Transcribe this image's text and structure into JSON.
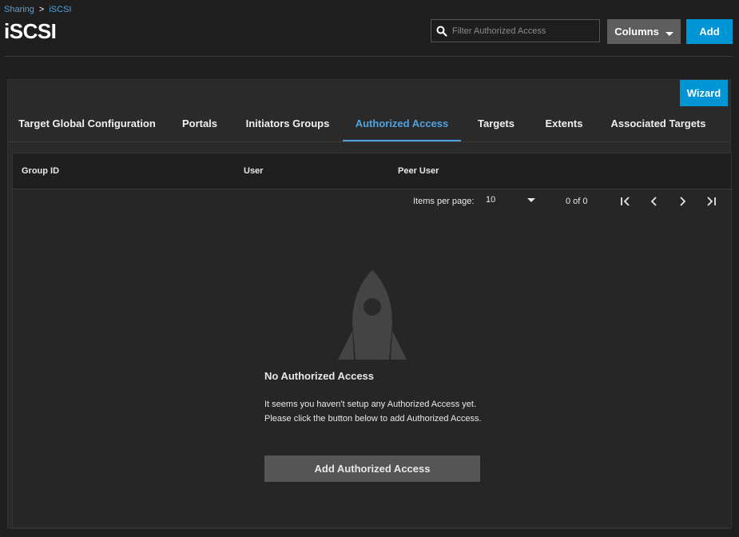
{
  "breadcrumb": {
    "parent": "Sharing",
    "separator": ">",
    "current": "iSCSI"
  },
  "page_title": "iSCSI",
  "search": {
    "placeholder": "Filter Authorized Access",
    "value": ""
  },
  "toolbar": {
    "columns_label": "Columns",
    "add_label": "Add"
  },
  "card": {
    "wizard_label": "Wizard"
  },
  "tabs": [
    {
      "label": "Target Global Configuration",
      "active": false
    },
    {
      "label": "Portals",
      "active": false
    },
    {
      "label": "Initiators Groups",
      "active": false
    },
    {
      "label": "Authorized Access",
      "active": true
    },
    {
      "label": "Targets",
      "active": false
    },
    {
      "label": "Extents",
      "active": false
    },
    {
      "label": "Associated Targets",
      "active": false
    }
  ],
  "table": {
    "columns": [
      "Group ID",
      "User",
      "Peer User"
    ]
  },
  "pagination": {
    "items_per_page_label": "Items per page:",
    "items_per_page": "10",
    "range": "0 of 0"
  },
  "empty_state": {
    "icon": "rocket-icon",
    "title": "No Authorized Access",
    "message": "It seems you haven't setup any Authorized Access yet. Please click the button below to add Authorized Access.",
    "button_label": "Add Authorized Access"
  },
  "colors": {
    "accent": "#0095d5",
    "link": "#4fa3e0",
    "background": "#1e1e1e",
    "card": "#2a2a2a"
  }
}
